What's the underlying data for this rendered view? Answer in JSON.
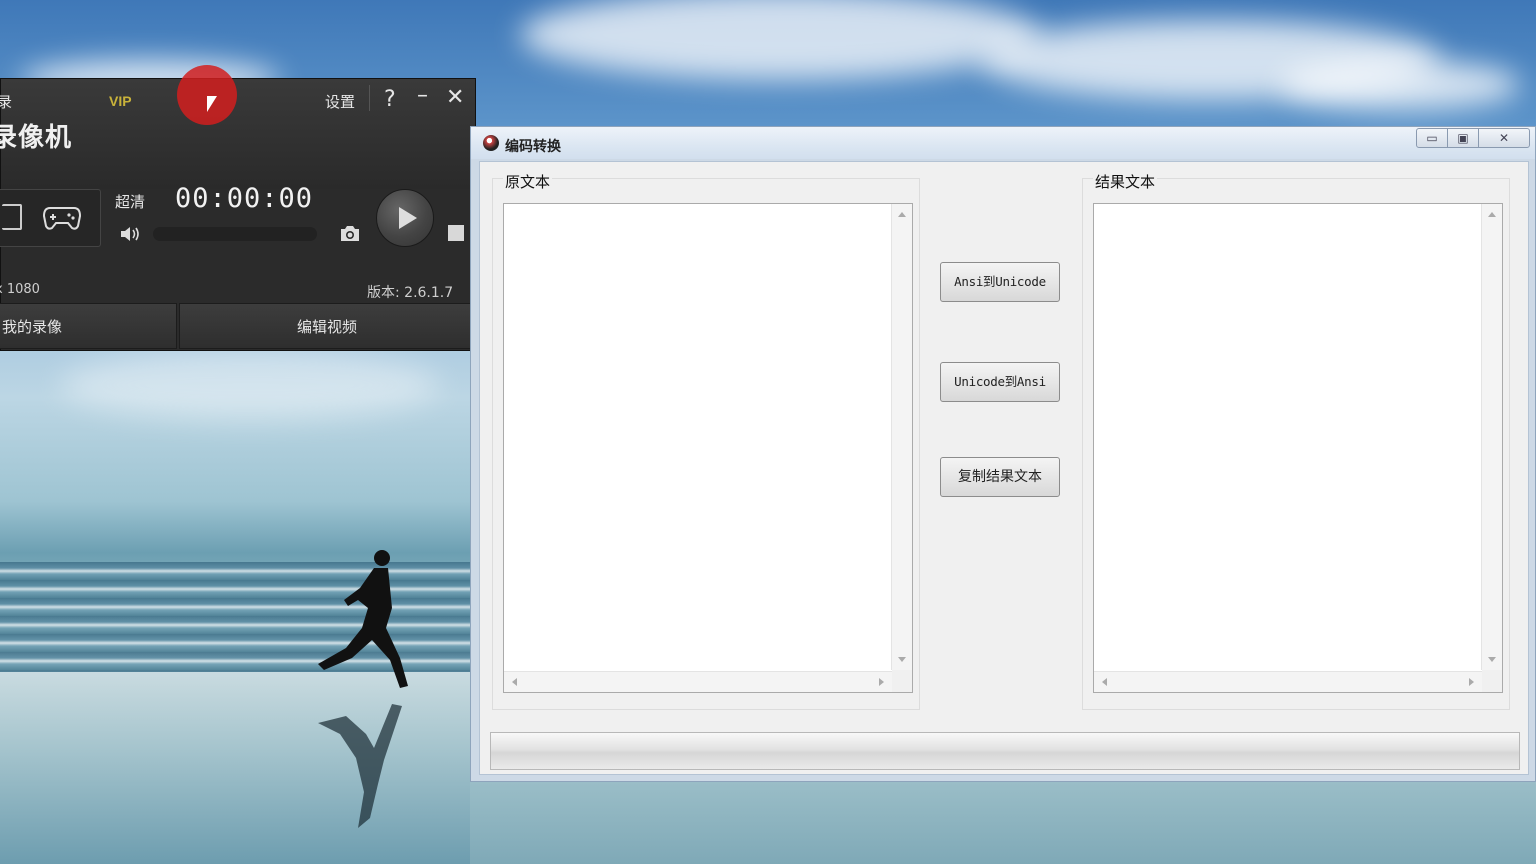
{
  "recorder": {
    "login_text": "录",
    "vip_label": "VIP",
    "settings_label": "设置",
    "help_label": "?",
    "minimize_label": "–",
    "close_label": "✕",
    "app_title": "录像机",
    "quality_label": "超清",
    "timer": "00:00:00",
    "resolution": "x 1080",
    "version": "版本: 2.6.1.7",
    "tabs": [
      {
        "label": "我的录像"
      },
      {
        "label": "编辑视频"
      }
    ]
  },
  "converter": {
    "title": "编码转换",
    "controls": {
      "minimize": "▭",
      "maximize": "▣",
      "close": "✕"
    },
    "source_label": "原文本",
    "source_value": "",
    "result_label": "结果文本",
    "result_value": "",
    "buttons": {
      "ansi_to_unicode": "Ansi到Unicode",
      "unicode_to_ansi": "Unicode到Ansi",
      "copy_result": "复制结果文本"
    },
    "status_text": ""
  }
}
